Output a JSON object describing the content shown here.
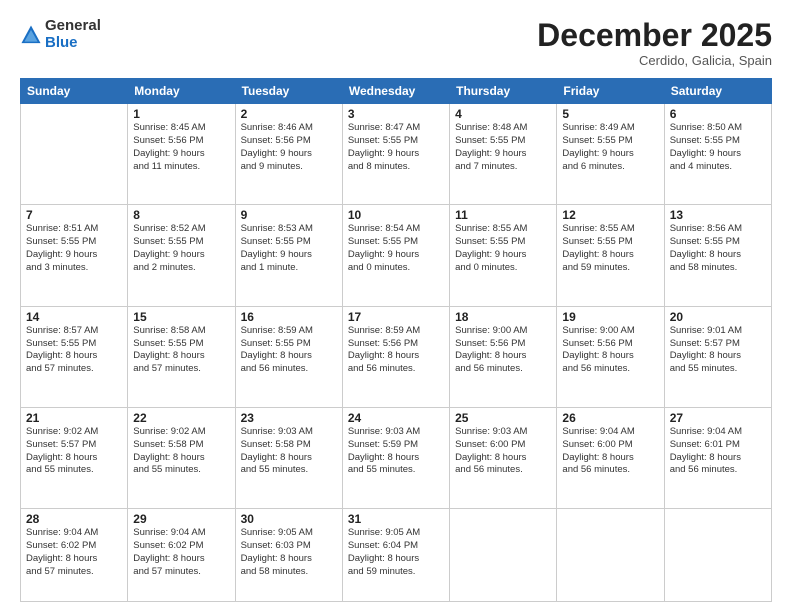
{
  "logo": {
    "general": "General",
    "blue": "Blue"
  },
  "header": {
    "month": "December 2025",
    "location": "Cerdido, Galicia, Spain"
  },
  "weekdays": [
    "Sunday",
    "Monday",
    "Tuesday",
    "Wednesday",
    "Thursday",
    "Friday",
    "Saturday"
  ],
  "weeks": [
    [
      {
        "day": "",
        "info": ""
      },
      {
        "day": "1",
        "info": "Sunrise: 8:45 AM\nSunset: 5:56 PM\nDaylight: 9 hours\nand 11 minutes."
      },
      {
        "day": "2",
        "info": "Sunrise: 8:46 AM\nSunset: 5:56 PM\nDaylight: 9 hours\nand 9 minutes."
      },
      {
        "day": "3",
        "info": "Sunrise: 8:47 AM\nSunset: 5:55 PM\nDaylight: 9 hours\nand 8 minutes."
      },
      {
        "day": "4",
        "info": "Sunrise: 8:48 AM\nSunset: 5:55 PM\nDaylight: 9 hours\nand 7 minutes."
      },
      {
        "day": "5",
        "info": "Sunrise: 8:49 AM\nSunset: 5:55 PM\nDaylight: 9 hours\nand 6 minutes."
      },
      {
        "day": "6",
        "info": "Sunrise: 8:50 AM\nSunset: 5:55 PM\nDaylight: 9 hours\nand 4 minutes."
      }
    ],
    [
      {
        "day": "7",
        "info": "Sunrise: 8:51 AM\nSunset: 5:55 PM\nDaylight: 9 hours\nand 3 minutes."
      },
      {
        "day": "8",
        "info": "Sunrise: 8:52 AM\nSunset: 5:55 PM\nDaylight: 9 hours\nand 2 minutes."
      },
      {
        "day": "9",
        "info": "Sunrise: 8:53 AM\nSunset: 5:55 PM\nDaylight: 9 hours\nand 1 minute."
      },
      {
        "day": "10",
        "info": "Sunrise: 8:54 AM\nSunset: 5:55 PM\nDaylight: 9 hours\nand 0 minutes."
      },
      {
        "day": "11",
        "info": "Sunrise: 8:55 AM\nSunset: 5:55 PM\nDaylight: 9 hours\nand 0 minutes."
      },
      {
        "day": "12",
        "info": "Sunrise: 8:55 AM\nSunset: 5:55 PM\nDaylight: 8 hours\nand 59 minutes."
      },
      {
        "day": "13",
        "info": "Sunrise: 8:56 AM\nSunset: 5:55 PM\nDaylight: 8 hours\nand 58 minutes."
      }
    ],
    [
      {
        "day": "14",
        "info": "Sunrise: 8:57 AM\nSunset: 5:55 PM\nDaylight: 8 hours\nand 57 minutes."
      },
      {
        "day": "15",
        "info": "Sunrise: 8:58 AM\nSunset: 5:55 PM\nDaylight: 8 hours\nand 57 minutes."
      },
      {
        "day": "16",
        "info": "Sunrise: 8:59 AM\nSunset: 5:55 PM\nDaylight: 8 hours\nand 56 minutes."
      },
      {
        "day": "17",
        "info": "Sunrise: 8:59 AM\nSunset: 5:56 PM\nDaylight: 8 hours\nand 56 minutes."
      },
      {
        "day": "18",
        "info": "Sunrise: 9:00 AM\nSunset: 5:56 PM\nDaylight: 8 hours\nand 56 minutes."
      },
      {
        "day": "19",
        "info": "Sunrise: 9:00 AM\nSunset: 5:56 PM\nDaylight: 8 hours\nand 56 minutes."
      },
      {
        "day": "20",
        "info": "Sunrise: 9:01 AM\nSunset: 5:57 PM\nDaylight: 8 hours\nand 55 minutes."
      }
    ],
    [
      {
        "day": "21",
        "info": "Sunrise: 9:02 AM\nSunset: 5:57 PM\nDaylight: 8 hours\nand 55 minutes."
      },
      {
        "day": "22",
        "info": "Sunrise: 9:02 AM\nSunset: 5:58 PM\nDaylight: 8 hours\nand 55 minutes."
      },
      {
        "day": "23",
        "info": "Sunrise: 9:03 AM\nSunset: 5:58 PM\nDaylight: 8 hours\nand 55 minutes."
      },
      {
        "day": "24",
        "info": "Sunrise: 9:03 AM\nSunset: 5:59 PM\nDaylight: 8 hours\nand 55 minutes."
      },
      {
        "day": "25",
        "info": "Sunrise: 9:03 AM\nSunset: 6:00 PM\nDaylight: 8 hours\nand 56 minutes."
      },
      {
        "day": "26",
        "info": "Sunrise: 9:04 AM\nSunset: 6:00 PM\nDaylight: 8 hours\nand 56 minutes."
      },
      {
        "day": "27",
        "info": "Sunrise: 9:04 AM\nSunset: 6:01 PM\nDaylight: 8 hours\nand 56 minutes."
      }
    ],
    [
      {
        "day": "28",
        "info": "Sunrise: 9:04 AM\nSunset: 6:02 PM\nDaylight: 8 hours\nand 57 minutes."
      },
      {
        "day": "29",
        "info": "Sunrise: 9:04 AM\nSunset: 6:02 PM\nDaylight: 8 hours\nand 57 minutes."
      },
      {
        "day": "30",
        "info": "Sunrise: 9:05 AM\nSunset: 6:03 PM\nDaylight: 8 hours\nand 58 minutes."
      },
      {
        "day": "31",
        "info": "Sunrise: 9:05 AM\nSunset: 6:04 PM\nDaylight: 8 hours\nand 59 minutes."
      },
      {
        "day": "",
        "info": ""
      },
      {
        "day": "",
        "info": ""
      },
      {
        "day": "",
        "info": ""
      }
    ]
  ]
}
